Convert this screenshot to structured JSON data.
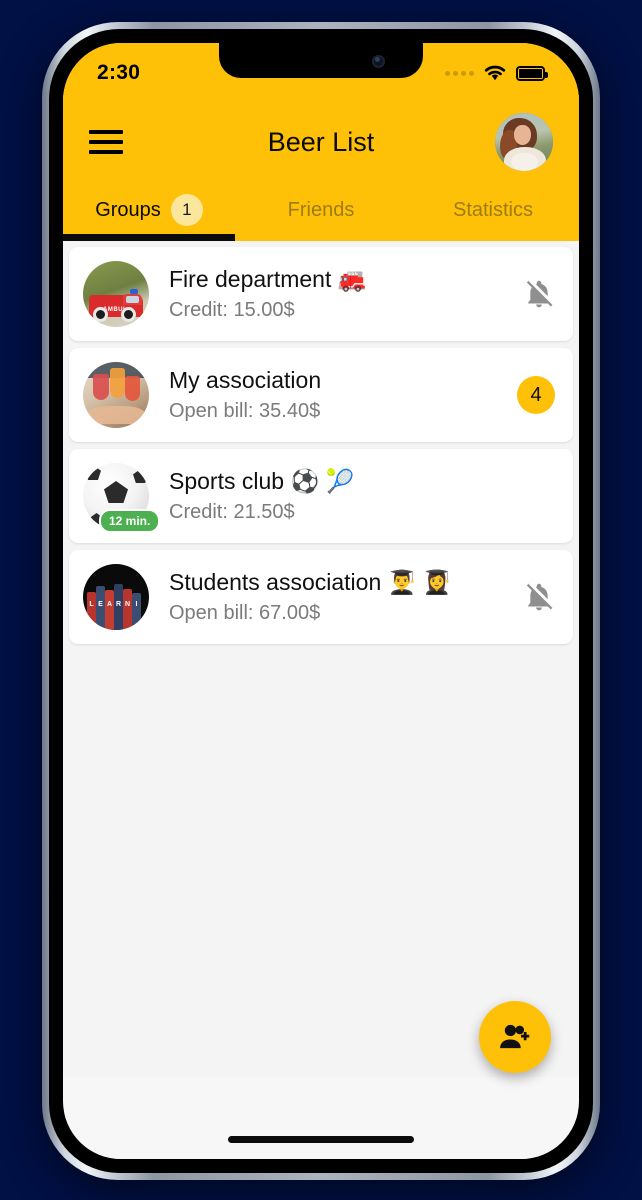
{
  "status_bar": {
    "time": "2:30",
    "signal_icon": "signal-dots-icon",
    "wifi_icon": "wifi-icon",
    "battery_icon": "battery-full-icon"
  },
  "appbar": {
    "menu_icon": "hamburger-menu-icon",
    "title": "Beer List",
    "avatar_icon": "user-avatar"
  },
  "tabs": [
    {
      "label": "Groups",
      "badge": "1",
      "active": true
    },
    {
      "label": "Friends",
      "badge": "",
      "active": false
    },
    {
      "label": "Statistics",
      "badge": "",
      "active": false
    }
  ],
  "groups": [
    {
      "title": "Fire department 🚒",
      "subtitle": "Credit: 15.00$",
      "trailing_type": "bell-off",
      "trailing_value": "",
      "time_badge": ""
    },
    {
      "title": "My association",
      "subtitle": "Open bill: 35.40$",
      "trailing_type": "count",
      "trailing_value": "4",
      "time_badge": ""
    },
    {
      "title": "Sports club ⚽ 🎾",
      "subtitle": "Credit: 21.50$",
      "trailing_type": "none",
      "trailing_value": "",
      "time_badge": "12 min."
    },
    {
      "title": "Students association 👨‍🎓 👩‍🎓",
      "subtitle": "Open bill: 67.00$",
      "trailing_type": "bell-off",
      "trailing_value": "",
      "time_badge": ""
    }
  ],
  "fab": {
    "icon": "person-add-icon",
    "label": ""
  },
  "colors": {
    "brand_yellow": "#FEC107",
    "badge_light_yellow": "#FBE79B",
    "green_badge": "#4CAF50",
    "page_background": "#011045",
    "list_background": "#F4F4F4"
  }
}
